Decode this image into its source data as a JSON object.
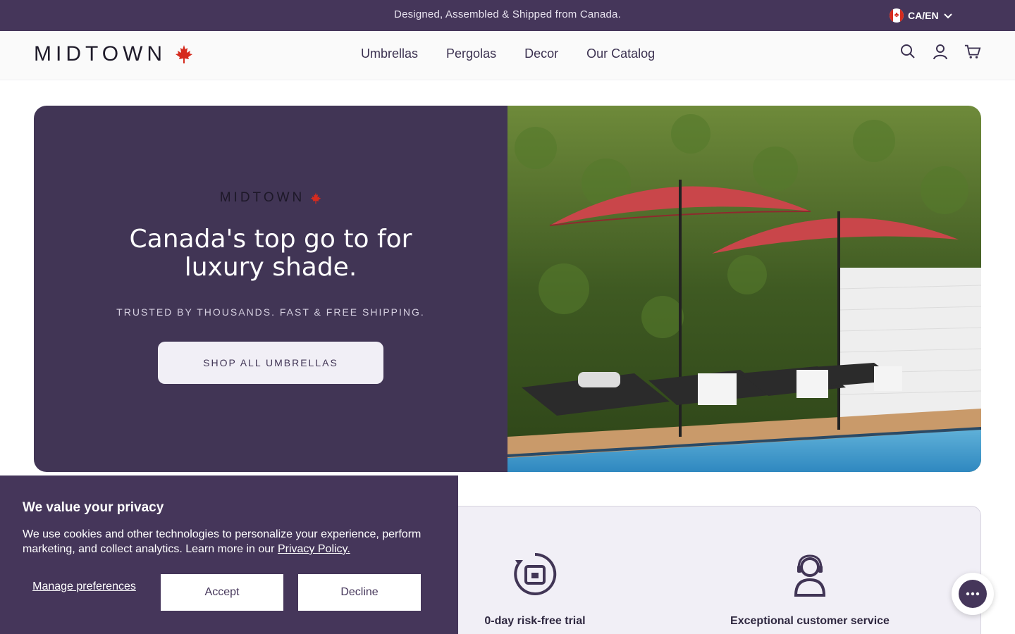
{
  "announcement": {
    "text": "Designed, Assembled & Shipped from Canada."
  },
  "locale": {
    "label": "CA/EN",
    "flag_icon": "canada-flag-icon"
  },
  "brand": {
    "name": "MIDTOWN",
    "icon": "maple-leaf-icon",
    "accent": "#d52b1e"
  },
  "nav": {
    "items": [
      {
        "label": "Umbrellas"
      },
      {
        "label": "Pergolas"
      },
      {
        "label": "Decor"
      },
      {
        "label": "Our Catalog"
      }
    ]
  },
  "header_icons": [
    "search-icon",
    "account-icon",
    "cart-icon"
  ],
  "hero": {
    "logo_text": "MIDTOWN",
    "title": "Canada's top go to for luxury shade.",
    "subtitle": "TRUSTED BY THOUSANDS. FAST & FREE SHIPPING.",
    "cta": "SHOP ALL UMBRELLAS",
    "background": "#413555"
  },
  "features": [
    {
      "label": "0-day risk-free trial",
      "icon": "trial-box-icon"
    },
    {
      "label": "Exceptional customer service",
      "icon": "support-agent-icon"
    }
  ],
  "cookie": {
    "title": "We value your privacy",
    "body": "We use cookies and other technologies to personalize your experience, perform marketing, and collect analytics. Learn more in our",
    "link": "Privacy Policy.",
    "manage": "Manage preferences",
    "accept": "Accept",
    "decline": "Decline"
  },
  "chat": {
    "icon": "chat-bubble-icon"
  },
  "colors": {
    "primary": "#45365a",
    "hero_bg": "#413555",
    "light": "#f1eff6"
  }
}
